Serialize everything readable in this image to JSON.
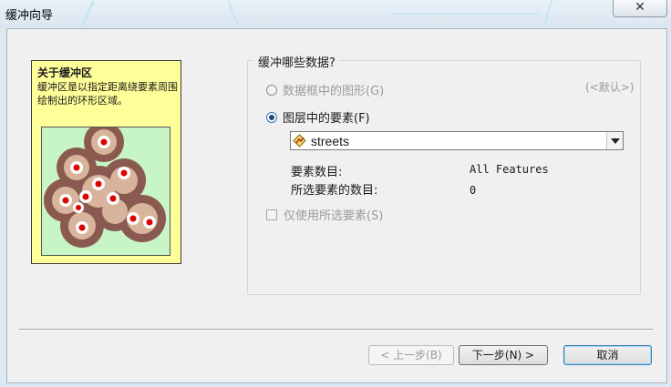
{
  "window": {
    "title": "缓冲向导",
    "close_glyph": "✕"
  },
  "info_panel": {
    "heading": "关于缓冲区",
    "description": "缓冲区是以指定距离绕要素周围绘制出的环形区域。"
  },
  "group": {
    "label": "缓冲哪些数据?",
    "option_graphics": "数据框中的图形(G)",
    "default_hint": "(<默认>)",
    "option_layer": "图层中的要素(F)",
    "layer_selected": "streets",
    "feature_count_label": "要素数目:",
    "feature_count_value": "All Features",
    "selected_count_label": "所选要素的数目:",
    "selected_count_value": "0",
    "use_selected_label": "仅使用所选要素(S)"
  },
  "buttons": {
    "back": "< 上一步(B)",
    "next": "下一步(N) >",
    "cancel": "取消"
  },
  "colors": {
    "panel_bg": "#ffff99",
    "map_bg": "#c8f5c8",
    "buffer_outer": "#8a5a50",
    "buffer_inner": "#d9b49c",
    "point": "#e00000"
  },
  "icons": {
    "layer": "line-layer-icon",
    "dropdown": "chevron-down-icon",
    "close": "close-icon"
  }
}
